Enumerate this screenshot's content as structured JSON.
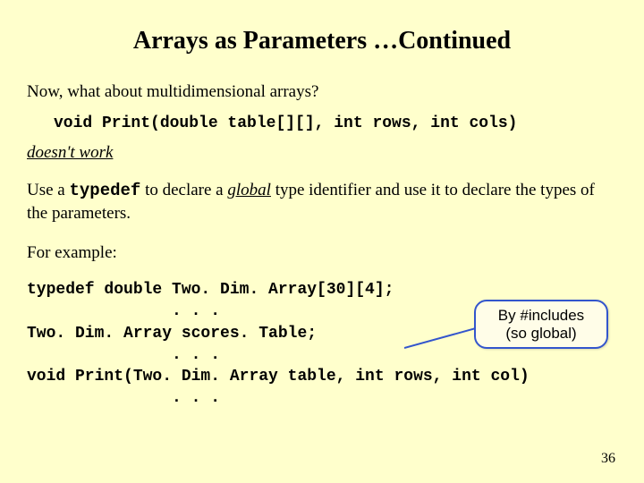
{
  "title": "Arrays as Parameters …Continued",
  "intro": "Now, what about multidimensional arrays?",
  "code_sig_bad": "void Print(double table[][], int rows, int cols)",
  "doesnt_work": "doesn't work",
  "typedef_sentence_prefix": "Use a ",
  "typedef_word": "typedef",
  "typedef_sentence_mid": " to declare a ",
  "global_word": "global",
  "typedef_sentence_suffix": " type identifier and use it to declare the types of the parameters.",
  "for_example": "For example:",
  "code_block": "typedef double Two. Dim. Array[30][4];\n               . . .\nTwo. Dim. Array scores. Table;\n               . . .\nvoid Print(Two. Dim. Array table, int rows, int col)\n               . . .",
  "callout_line1": "By #includes",
  "callout_line2": "(so global)",
  "page_number": "36"
}
